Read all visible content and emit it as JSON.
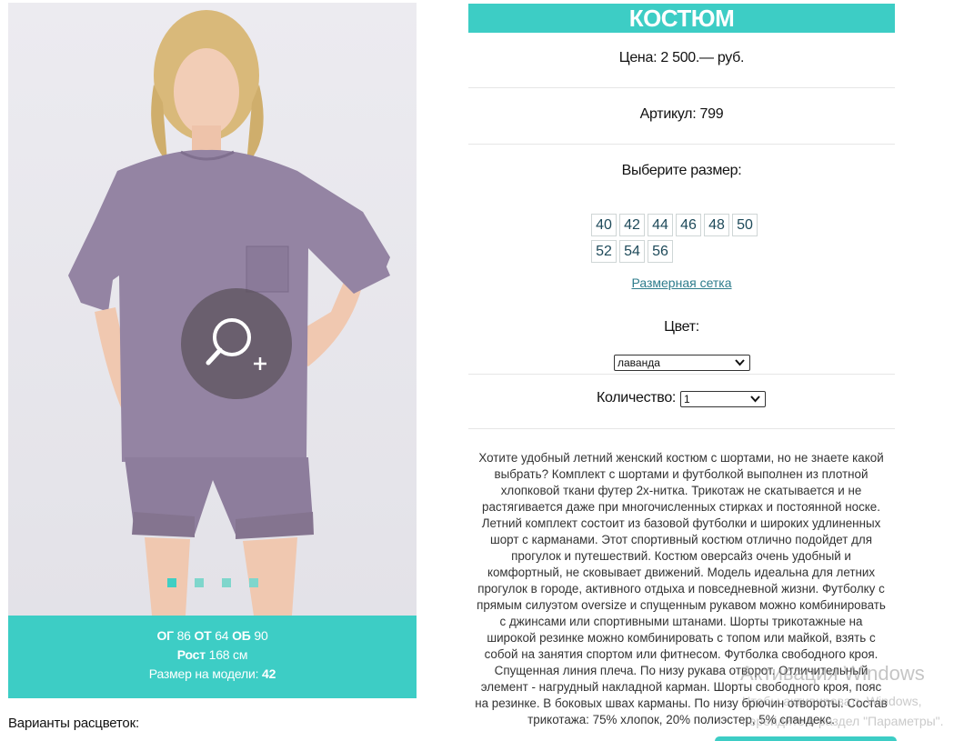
{
  "product": {
    "title": "КОСТЮМ",
    "price_text": "Цена: 2 500.— руб.",
    "sku_text": "Артикул: 799",
    "choose_size_label": "Выберите размер:",
    "sizes_row1": [
      "40",
      "42",
      "44",
      "46",
      "48",
      "50"
    ],
    "sizes_row2": [
      "52",
      "54",
      "56"
    ],
    "size_chart_link": "Размерная сетка",
    "color_label": "Цвет:",
    "color_value": "лаванда",
    "quantity_label": "Количество:",
    "quantity_value": "1",
    "description": "Хотите удобный летний женский костюм с шортами, но не знаете какой выбрать? Комплект с шортами и футболкой выполнен из плотной хлопковой ткани футер 2х-нитка. Трикотаж не скатывается и не растягивается даже при многочисленных стирках и постоянной носке. Летний комплект состоит из базовой футболки и широких удлиненных шорт с карманами. Этот спортивный костюм отлично подойдет для прогулок и путешествий. Костюм оверсайз очень удобный и комфортный, не сковывает движений. Модель идеальна для летних прогулок в городе, активного отдыха и повседневной жизни. Футболку с прямым силуэтом oversize и спущенным рукавом можно комбинировать с джинсами или спортивными штанами. Шорты трикотажные на широкой резинке можно комбинировать с топом или майкой, взять с собой на занятия спортом или фитнесом. Футболка свободного кроя. Спущенная линия плеча. По низу рукава отворот. Отличительный элемент - нагрудный накладной карман. Шорты свободного кроя, пояс на резинке. В боковых швах карманы. По низу брючин отвороты. Состав трикотажа: 75% хлопок, 20% полиэстер, 5% спандекс."
  },
  "model": {
    "og_label": "ОГ",
    "og_value": "86",
    "ot_label": "ОТ",
    "ot_value": "64",
    "ob_label": "ОБ",
    "ob_value": "90",
    "height_label": "Рост",
    "height_value": "168 см",
    "size_label": "Размер на модели:",
    "size_value": "42"
  },
  "gallery": {
    "zoom_icon": "zoom-in-icon",
    "dots_count": 4,
    "active_dot": 0
  },
  "variants_title": "Варианты расцветок:",
  "watermark": {
    "line1": "Активация Windows",
    "line2": "Чтобы активировать Windows,",
    "line3": "перейдите в раздел \"Параметры\"."
  },
  "colors": {
    "accent": "#3dcdc5",
    "link": "#2e7c8c",
    "garment": "#9484a3"
  }
}
